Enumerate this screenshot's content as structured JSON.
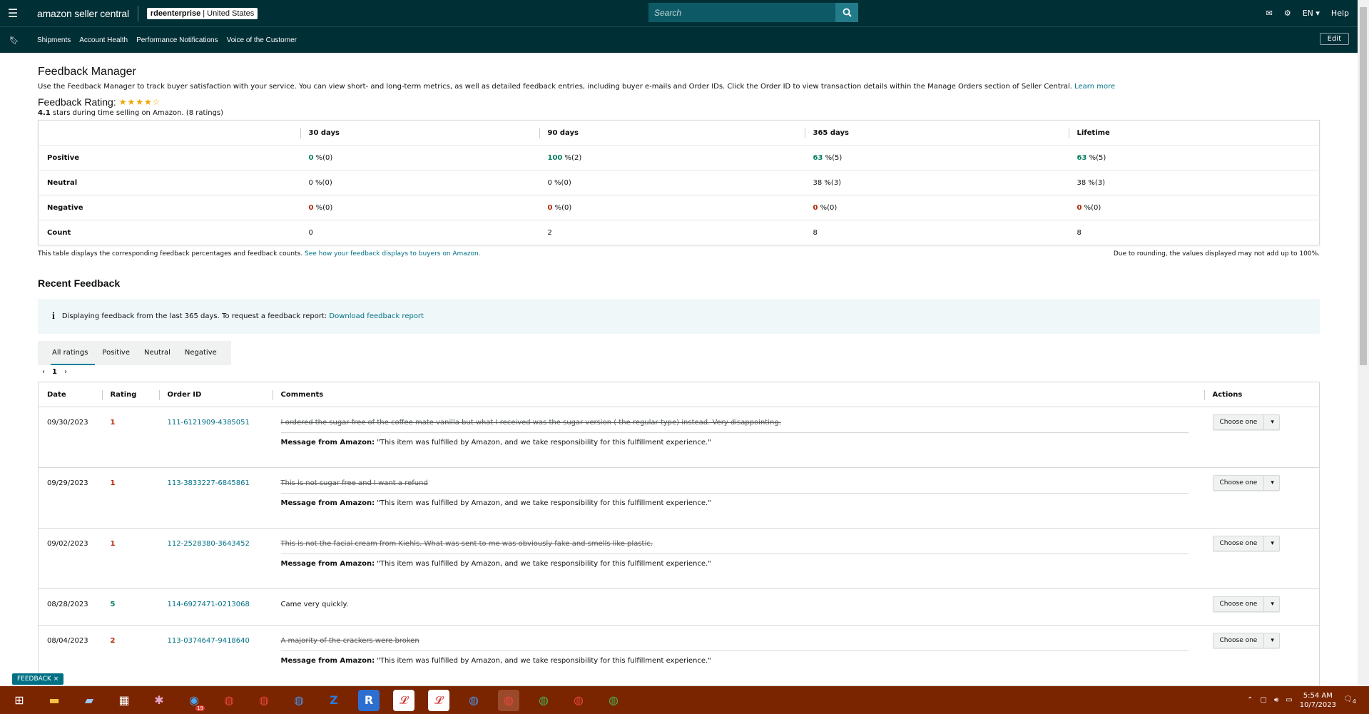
{
  "header": {
    "logo_bold": "amazon",
    "logo_rest": " seller central",
    "account_bold": "rdeenterprise",
    "account_rest": " | United States",
    "search_placeholder": "Search",
    "language": "EN",
    "help": "Help",
    "edit": "Edit"
  },
  "subnav": [
    "Shipments",
    "Account Health",
    "Performance Notifications",
    "Voice of the Customer"
  ],
  "page": {
    "title": "Feedback Manager",
    "description": "Use the Feedback Manager to track buyer satisfaction with your service. You can view short- and long-term metrics, as well as detailed feedback entries, including buyer e-mails and Order IDs. Click the Order ID to view transaction details within the Manage Orders section of Seller Central.",
    "learn_more": "Learn more",
    "rating_label": "Feedback Rating:",
    "rating_stars": 4.1,
    "rating_value": "4.1",
    "rating_text": "stars during time selling on Amazon. (8 ratings)"
  },
  "metrics": {
    "columns": [
      "30 days",
      "90 days",
      "365 days",
      "Lifetime"
    ],
    "rows": [
      {
        "label": "Positive",
        "cells": [
          [
            "0",
            " %(0)"
          ],
          [
            "100",
            " %(2)"
          ],
          [
            "63",
            " %(5)"
          ],
          [
            "63",
            " %(5)"
          ]
        ],
        "kind": "positive"
      },
      {
        "label": "Neutral",
        "cells": [
          [
            "0",
            " %(0)"
          ],
          [
            "0",
            " %(0)"
          ],
          [
            "38",
            " %(3)"
          ],
          [
            "38",
            " %(3)"
          ]
        ],
        "kind": "neutral"
      },
      {
        "label": "Negative",
        "cells": [
          [
            "0",
            " %(0)"
          ],
          [
            "0",
            " %(0)"
          ],
          [
            "0",
            " %(0)"
          ],
          [
            "0",
            " %(0)"
          ]
        ],
        "kind": "negative"
      },
      {
        "label": "Count",
        "cells": [
          [
            "0",
            ""
          ],
          [
            "2",
            ""
          ],
          [
            "8",
            ""
          ],
          [
            "8",
            ""
          ]
        ],
        "kind": "count"
      }
    ],
    "note_left": "This table displays the corresponding feedback percentages and feedback counts.",
    "note_link": "See how your feedback displays to buyers on Amazon.",
    "note_right": "Due to rounding, the values displayed may not add up to 100%."
  },
  "recent": {
    "title": "Recent Feedback",
    "info_text": "Displaying feedback from the last 365 days. To request a feedback report:",
    "info_link": "Download feedback report",
    "tabs": [
      "All ratings",
      "Positive",
      "Neutral",
      "Negative"
    ],
    "page": "1",
    "columns": [
      "Date",
      "Rating",
      "Order ID",
      "Comments",
      "Actions"
    ],
    "message_label": "Message from Amazon:",
    "message_text": " \"This item was fulfilled by Amazon, and we take responsibility for this fulfillment experience.\"",
    "action_label": "Choose one",
    "rows": [
      {
        "date": "09/30/2023",
        "rating": "1",
        "order": "111-6121909-4385051",
        "comment": "I ordered the sugar free of the coffee mate vanilla but what I received was the sugar version ( the regular type) instead. Very disappointing.",
        "struck": true
      },
      {
        "date": "09/29/2023",
        "rating": "1",
        "order": "113-3833227-6845861",
        "comment": "This is not sugar free and I want a refund",
        "struck": true
      },
      {
        "date": "09/02/2023",
        "rating": "1",
        "order": "112-2528380-3643452",
        "comment": "This is not the facial cream from Kiehls. What was sent to me was obviously fake and smells like plastic.",
        "struck": true
      },
      {
        "date": "08/28/2023",
        "rating": "5",
        "order": "114-6927471-0213068",
        "comment": "Came very quickly.",
        "struck": false
      },
      {
        "date": "08/04/2023",
        "rating": "2",
        "order": "113-0374647-9418640",
        "comment": "A majority of the crackers were broken",
        "struck": true
      }
    ]
  },
  "feedback_tab": "FEEDBACK ×",
  "taskbar": {
    "time": "5:54 AM",
    "date": "10/7/2023",
    "badge": "19",
    "notif": "4"
  },
  "colors": {
    "nav": "#002f36",
    "link": "#007185",
    "positive": "#067d62",
    "negative": "#b12704",
    "taskbar": "#7a2400"
  }
}
